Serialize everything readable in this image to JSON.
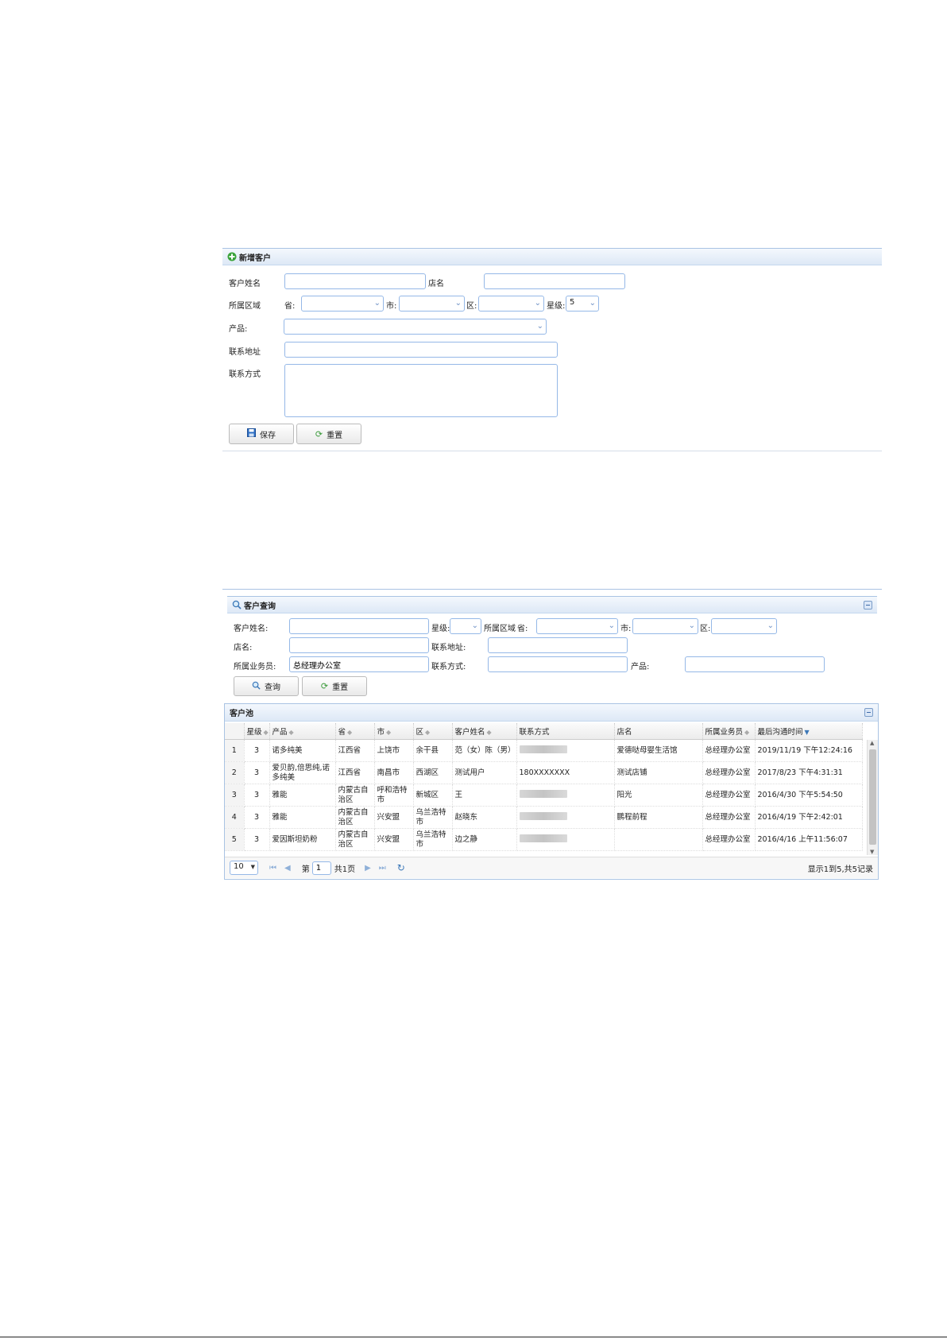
{
  "add_panel": {
    "title": "新增客户",
    "name_label": "客户姓名",
    "shop_label": "店名",
    "region_label": "所属区域",
    "province_label": "省:",
    "city_label": "市:",
    "district_label": "区:",
    "star_label": "星级:",
    "star_value": "5",
    "product_label": "产品:",
    "address_label": "联系地址",
    "contact_label": "联系方式",
    "save_label": "保存",
    "reset_label": "重置"
  },
  "query_panel": {
    "title": "客户查询",
    "name_label": "客户姓名:",
    "star_label": "星级:",
    "region_label": "所属区域",
    "province_label": "省:",
    "city_label": "市:",
    "district_label": "区:",
    "shop_label": "店名:",
    "address_label": "联系地址:",
    "salesman_label": "所属业务员:",
    "salesman_value": "总经理办公室",
    "contact_label": "联系方式:",
    "product_label": "产品:",
    "query_label": "查询",
    "reset_label": "重置"
  },
  "grid": {
    "title": "客户池",
    "columns": [
      "星级",
      "产品",
      "省",
      "市",
      "区",
      "客户姓名",
      "联系方式",
      "店名",
      "所属业务员",
      "最后沟通时间"
    ],
    "rows": [
      {
        "no": "1",
        "star": "3",
        "product": "诺多纯美",
        "province": "江西省",
        "city": "上饶市",
        "district": "余干县",
        "name": "范（女）陈（男）",
        "contact": "",
        "shop": "爱德哒母婴生活馆",
        "salesman": "总经理办公室",
        "time": "2019/11/19 下午12:24:16"
      },
      {
        "no": "2",
        "star": "3",
        "product": "爱贝韵,倍思纯,诺多纯美",
        "province": "江西省",
        "city": "南昌市",
        "district": "西湖区",
        "name": "测试用户",
        "contact": "180XXXXXXX",
        "shop": "测试店铺",
        "salesman": "总经理办公室",
        "time": "2017/8/23 下午4:31:31"
      },
      {
        "no": "3",
        "star": "3",
        "product": "雅能",
        "province": "内蒙古自治区",
        "city": "呼和浩特市",
        "district": "新城区",
        "name": "王",
        "contact": "",
        "shop": "阳光",
        "salesman": "总经理办公室",
        "time": "2016/4/30 下午5:54:50"
      },
      {
        "no": "4",
        "star": "3",
        "product": "雅能",
        "province": "内蒙古自治区",
        "city": "兴安盟",
        "district": "乌兰浩特市",
        "name": "赵晓东",
        "contact": "",
        "shop": "鹏程前程",
        "salesman": "总经理办公室",
        "time": "2016/4/19 下午2:42:01"
      },
      {
        "no": "5",
        "star": "3",
        "product": "爱因斯坦奶粉",
        "province": "内蒙古自治区",
        "city": "兴安盟",
        "district": "乌兰浩特市",
        "name": "边之静",
        "contact": "",
        "shop": "",
        "salesman": "总经理办公室",
        "time": "2016/4/16 上午11:56:07"
      }
    ],
    "page_size": "10",
    "page_prefix": "第",
    "page_number": "1",
    "page_total": "共1页",
    "summary": "显示1到5,共5记录"
  }
}
